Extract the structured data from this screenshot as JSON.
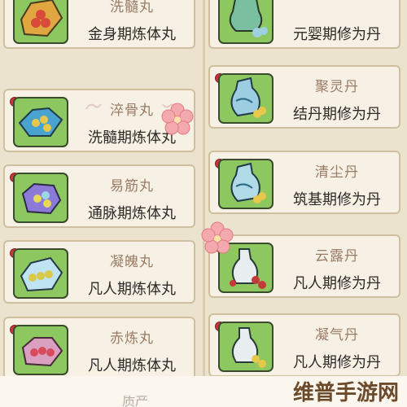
{
  "left_column": [
    {
      "name": "洗髓丸",
      "requirement": "金身期炼体丸",
      "icon": "cloth-with-beads-icon"
    },
    {
      "name": "淬骨丸",
      "requirement": "洗髓期炼体丸",
      "icon": "blue-cloth-with-beads-icon"
    },
    {
      "name": "易筋丸",
      "requirement": "通脉期炼体丸",
      "icon": "purple-cloth-with-beads-icon"
    },
    {
      "name": "凝魄丸",
      "requirement": "凡人期炼体丸",
      "icon": "teal-cloth-with-beads-icon"
    },
    {
      "name": "赤炼丸",
      "requirement": "凡人期炼体丸",
      "icon": "pink-cloth-with-beads-icon"
    }
  ],
  "right_column": [
    {
      "name": "",
      "requirement": "元婴期修为丹",
      "icon": "green-gourd-icon"
    },
    {
      "name": "聚灵丹",
      "requirement": "结丹期修为丹",
      "icon": "blue-vase-icon"
    },
    {
      "name": "清尘丹",
      "requirement": "筑基期修为丹",
      "icon": "blue-vase-icon"
    },
    {
      "name": "云露丹",
      "requirement": "凡人期修为丹",
      "icon": "white-vase-icon"
    },
    {
      "name": "凝气丹",
      "requirement": "凡人期修为丹",
      "icon": "white-vase-icon"
    }
  ],
  "bottom": {
    "partial_text": "质产"
  },
  "watermark": "维普手游网",
  "colors": {
    "icon_bg": "#8cc760",
    "badge": "#d6303b",
    "card_bg": "#f6f1e4",
    "name_text": "#9a7b66"
  }
}
